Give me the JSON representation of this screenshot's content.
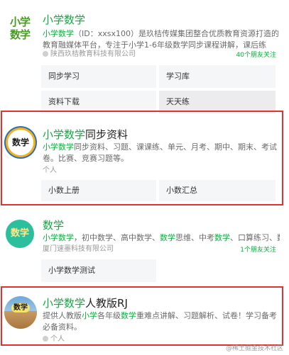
{
  "accounts": [
    {
      "title_highlight": "小学数学",
      "title_rest": "",
      "desc_highlight": "小学数学",
      "desc_rest": "（ID：xxsx100）是玖桔传媒集团整合优质教育资源打造的教育融媒体平台，专注于小学1-6年级数学同步课程讲解，课后练习，模拟考及详",
      "owner": "陕西玖桔教育科技有限公司",
      "friends": "40个朋友关注",
      "logo_text": "小学\n数学",
      "menu": [
        "同步学习",
        "学习库",
        "资料下载",
        "天天练"
      ]
    },
    {
      "title_highlight": "小学数学",
      "title_rest": "同步资料",
      "desc_highlight": "小学数学",
      "desc_rest": "同步资料、习题、课课练、单元、月考、期中、期末、考试卷。比赛、竞赛习题等。",
      "owner": "个人",
      "logo_text": "数学",
      "menu": [
        "小数上册",
        "小数汇总"
      ]
    },
    {
      "title_highlight": "数学",
      "title_rest": "",
      "desc_parts": [
        "小学数学",
        "，初中数学、高中数学、",
        "数学",
        "思维、中考",
        "数学",
        "、口算练习、数学..."
      ],
      "owner": "厦门速墨科技有限公司",
      "friends": "1个朋友关注",
      "logo_text": "数学",
      "menu": [
        "小学数学测试"
      ]
    },
    {
      "title_highlight": "小学数学",
      "title_rest": "人教版RJ",
      "desc_parts": [
        "提供人教版",
        "小学",
        "各年级",
        "数学",
        "重难点讲解、习题解析、试卷！学习备考必备资料。"
      ],
      "owner": "个人",
      "logo_text": "数学"
    }
  ],
  "watermark": "@稀土掘金技术社区",
  "colors": {
    "accent": "#07b03b",
    "highlight_box": "#e23131"
  }
}
